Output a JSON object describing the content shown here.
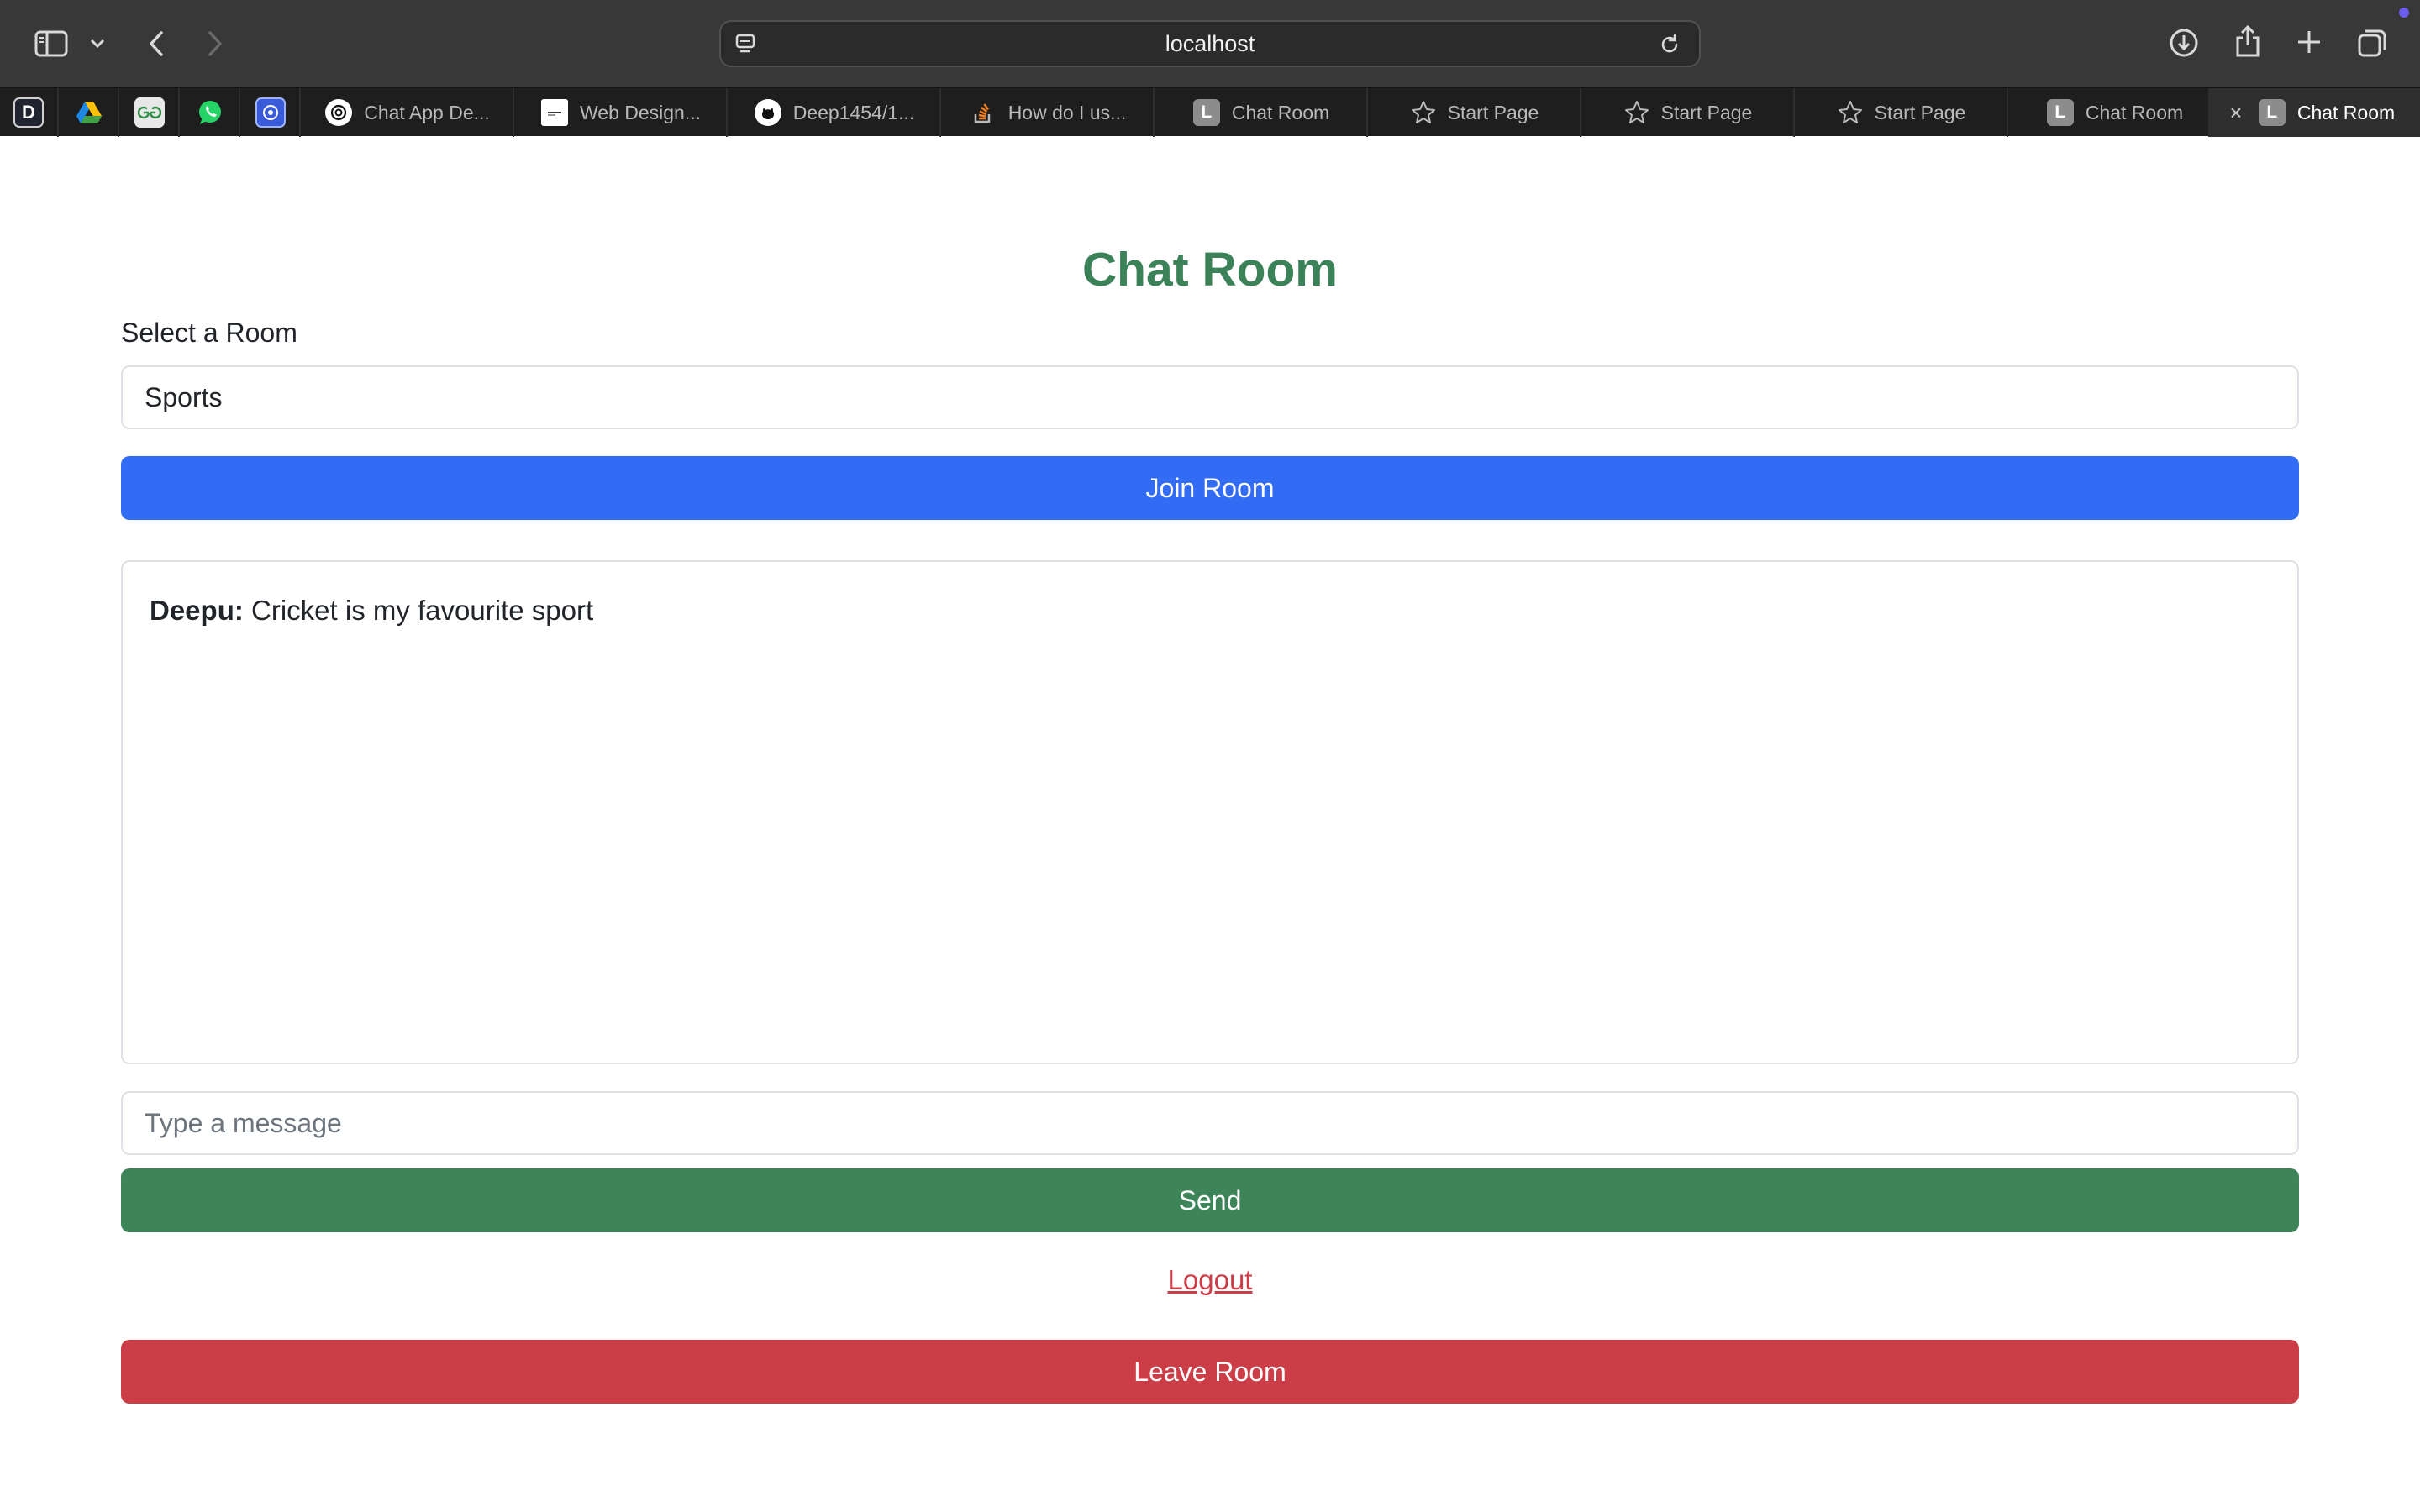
{
  "browser": {
    "url": "localhost",
    "pinned_tabs": [
      {
        "icon": "d-letter-icon",
        "label": "D"
      },
      {
        "icon": "google-drive-icon",
        "label": ""
      },
      {
        "icon": "geeksforgeeks-icon",
        "label": ""
      },
      {
        "icon": "whatsapp-icon",
        "label": ""
      },
      {
        "icon": "app-icon",
        "label": ""
      }
    ],
    "tabs": [
      {
        "title": "Chat App De...",
        "icon": "openai-icon",
        "active": false
      },
      {
        "title": "Web Design...",
        "icon": "site-icon",
        "active": false
      },
      {
        "title": "Deep1454/1...",
        "icon": "github-icon",
        "active": false
      },
      {
        "title": "How do I us...",
        "icon": "stackoverflow-icon",
        "active": false
      },
      {
        "title": "Chat Room",
        "icon": "L",
        "active": false
      },
      {
        "title": "Start Page",
        "icon": "star-icon",
        "active": false
      },
      {
        "title": "Start Page",
        "icon": "star-icon",
        "active": false
      },
      {
        "title": "Start Page",
        "icon": "star-icon",
        "active": false
      },
      {
        "title": "Chat Room",
        "icon": "L",
        "active": false
      },
      {
        "title": "Chat Room",
        "icon": "L",
        "active": true
      }
    ]
  },
  "page": {
    "title": "Chat Room",
    "room_label": "Select a Room",
    "selected_room": "Sports",
    "join_button": "Join Room",
    "messages": [
      {
        "sender": "Deepu:",
        "text": "Cricket is my favourite sport"
      }
    ],
    "message_placeholder": "Type a message",
    "send_button": "Send",
    "logout_link": "Logout",
    "leave_button": "Leave Room"
  },
  "colors": {
    "title": "#3b8259",
    "join": "#336cf4",
    "send": "#3d8558",
    "leave": "#cc3e47"
  }
}
